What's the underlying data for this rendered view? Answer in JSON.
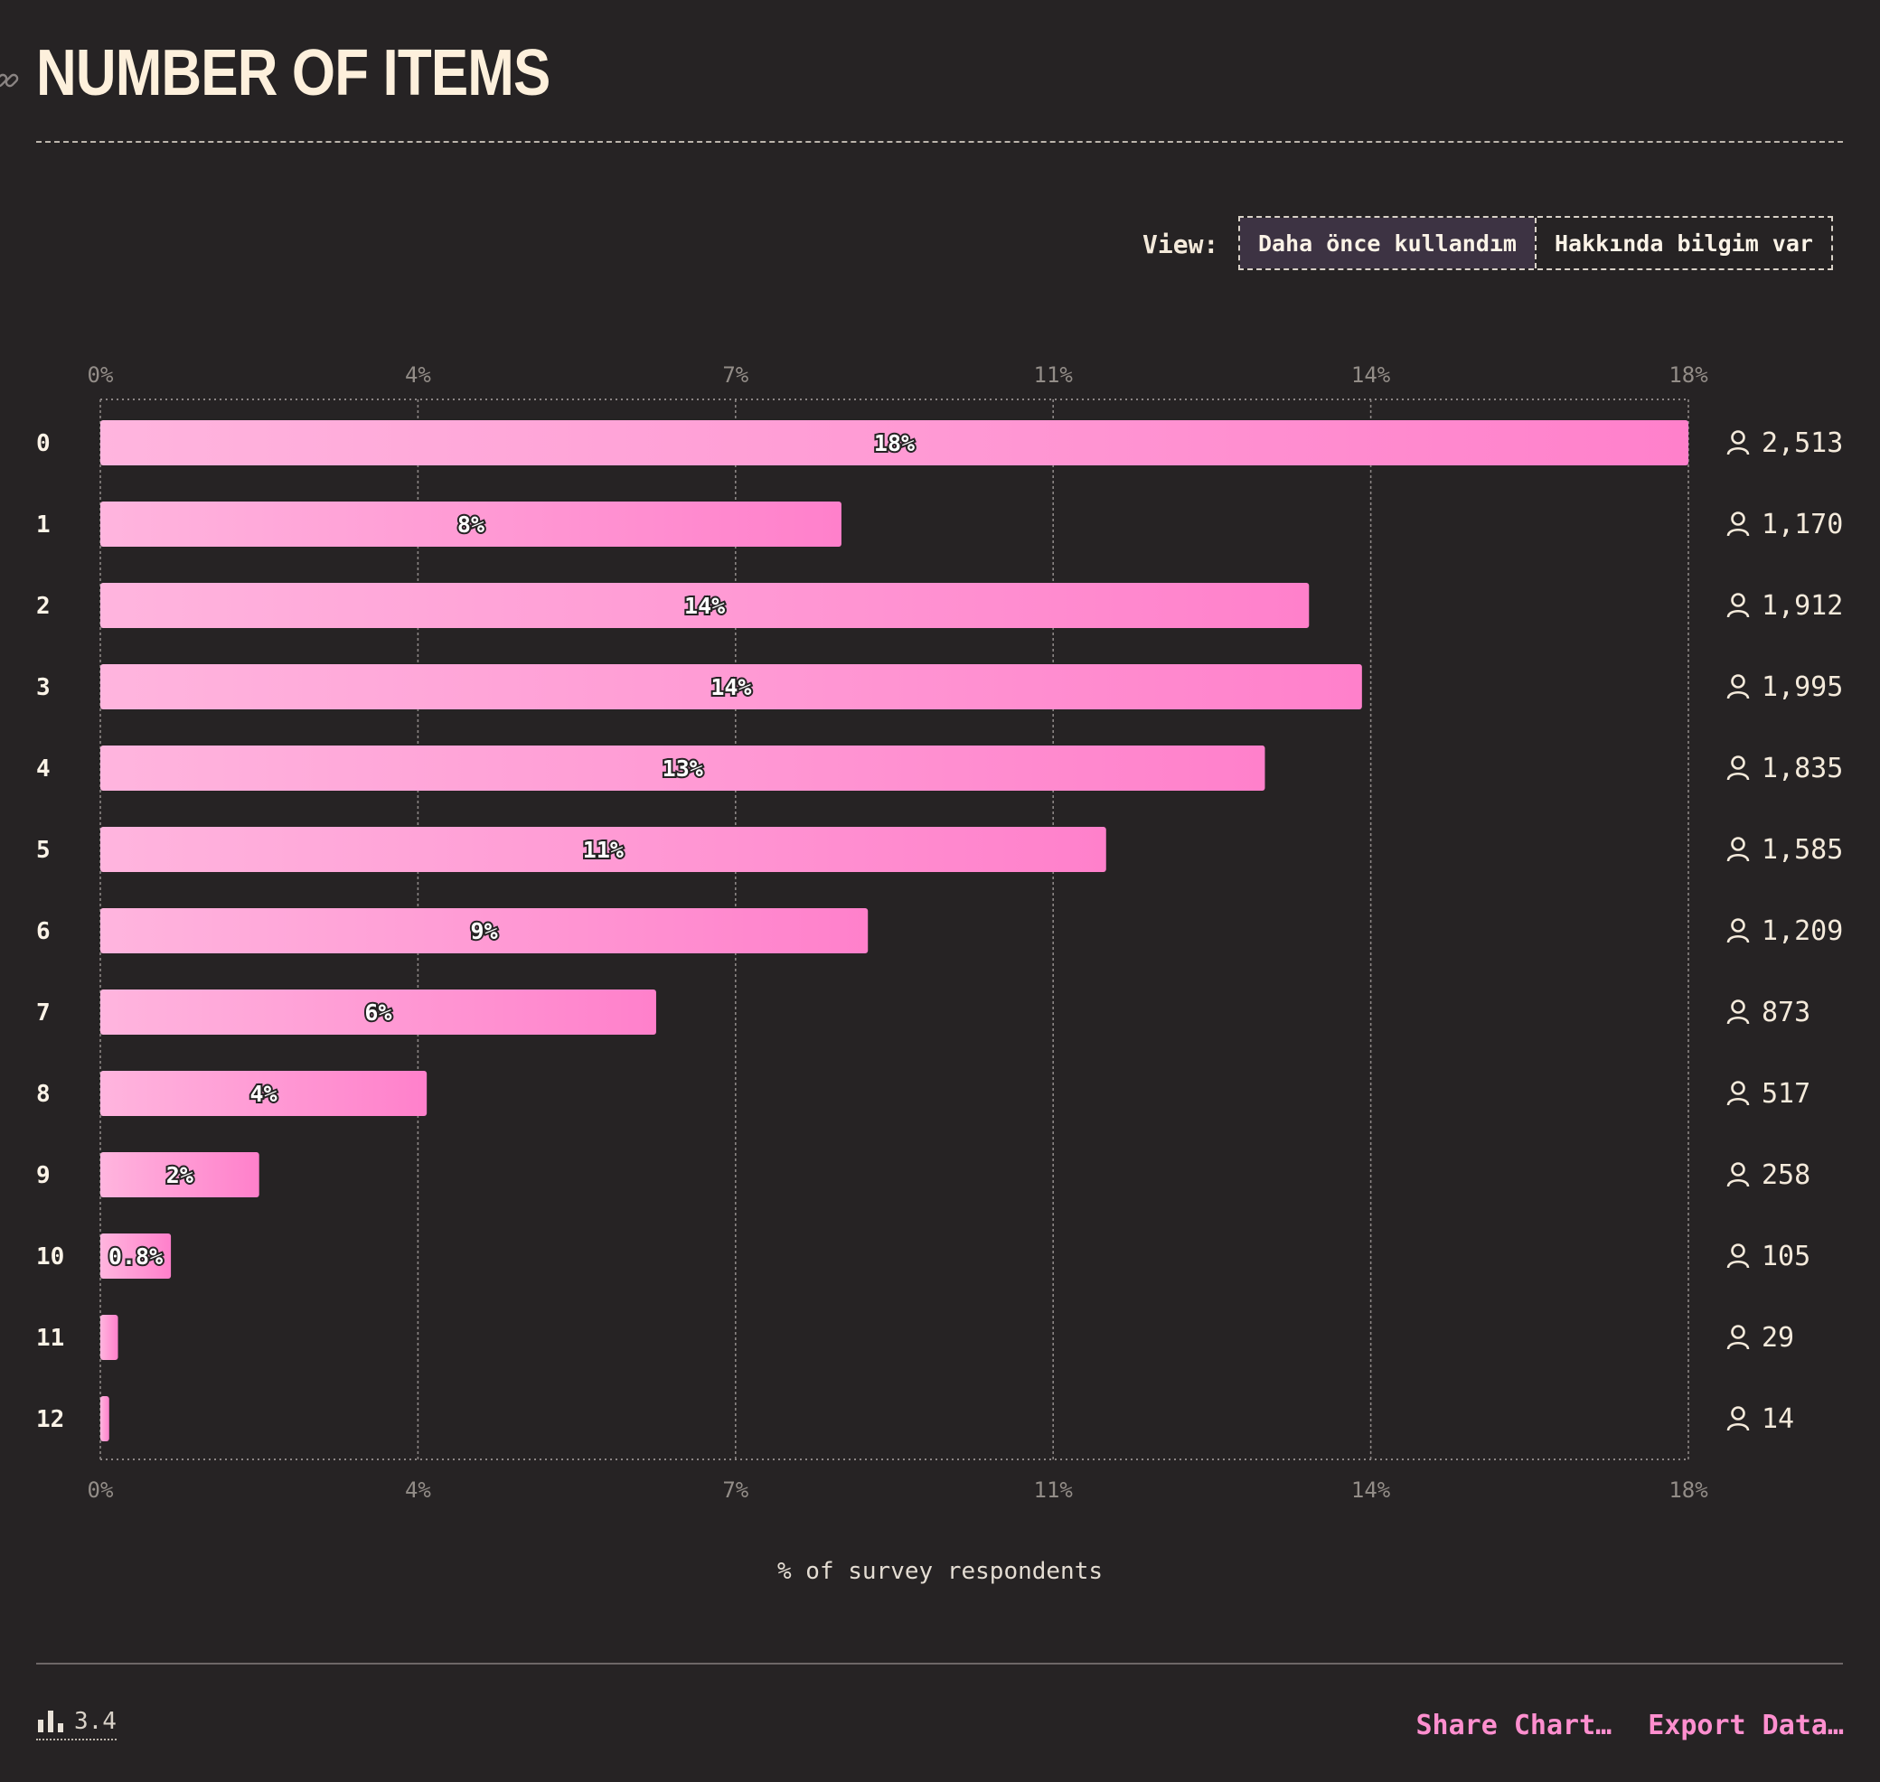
{
  "header": {
    "title": "NUMBER OF ITEMS"
  },
  "view": {
    "label": "View:",
    "options": [
      "Daha önce kullandım",
      "Hakkında bilgim var"
    ],
    "selected": "Daha önce kullandım"
  },
  "footer": {
    "version": "3.4",
    "share_label": "Share Chart…",
    "export_label": "Export Data…"
  },
  "colors": {
    "background": "#262324",
    "bar_start": "#ffb5de",
    "bar_end": "#ff80cb",
    "accent": "#ff8fcf",
    "text": "#f4eadb"
  },
  "chart_data": {
    "type": "bar",
    "orientation": "horizontal",
    "categories": [
      "0",
      "1",
      "2",
      "3",
      "4",
      "5",
      "6",
      "7",
      "8",
      "9",
      "10",
      "11",
      "12"
    ],
    "values": [
      18,
      8.4,
      13.7,
      14.3,
      13.2,
      11.4,
      8.7,
      6.3,
      3.7,
      1.8,
      0.8,
      0.2,
      0.1
    ],
    "data_labels": [
      "18%",
      "8%",
      "14%",
      "14%",
      "13%",
      "11%",
      "9%",
      "6%",
      "4%",
      "2%",
      "0.8%",
      "",
      ""
    ],
    "respondent_counts": [
      "2,513",
      "1,170",
      "1,912",
      "1,995",
      "1,835",
      "1,585",
      "1,209",
      "873",
      "517",
      "258",
      "105",
      "29",
      "14"
    ],
    "count_icon": "person-icon",
    "x_ticks": [
      0,
      3.6,
      7.2,
      10.8,
      14.4,
      18
    ],
    "x_tick_labels": [
      "0%",
      "4%",
      "7%",
      "11%",
      "14%",
      "18%"
    ],
    "xlim": [
      0,
      18
    ],
    "xlabel": "% of survey respondents",
    "grid": true
  }
}
